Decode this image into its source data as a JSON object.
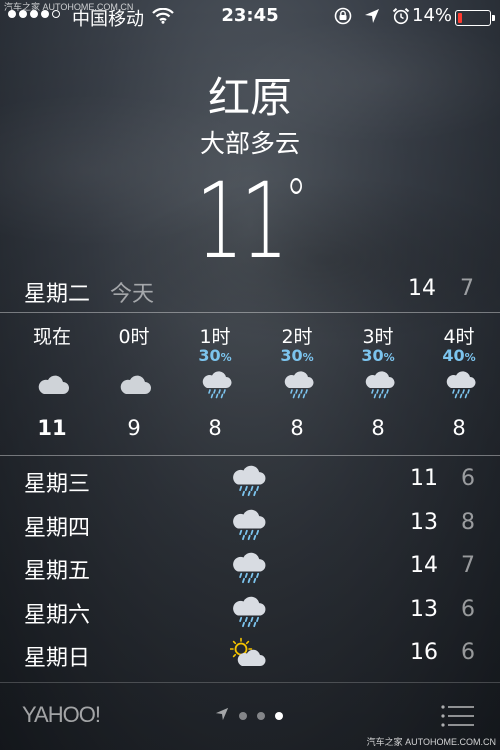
{
  "status_bar": {
    "carrier": "中国移动",
    "time": "23:45",
    "battery_percent": "14%",
    "battery_level": 0.14,
    "battery_color": "#ff3b30",
    "icons": [
      "orientation-lock-icon",
      "location-arrow-icon",
      "alarm-icon"
    ]
  },
  "watermark": {
    "top": "汽车之家 AUTOHOME.COM.CN",
    "bottom": "汽车之家 AUTOHOME.COM.CN"
  },
  "location": {
    "city": "红原",
    "condition": "大部多云",
    "temperature": "11",
    "degree": "°"
  },
  "today": {
    "day": "星期二",
    "label": "今天",
    "high": "14",
    "low": "7"
  },
  "hourly": [
    {
      "label": "现在",
      "precip": "",
      "pct": "",
      "icon": "cloud-icon",
      "temp": "11"
    },
    {
      "label": "0时",
      "precip": "",
      "pct": "",
      "icon": "cloud-icon",
      "temp": "9"
    },
    {
      "label": "1时",
      "precip": "30",
      "pct": "%",
      "icon": "rain-cloud-icon",
      "temp": "8"
    },
    {
      "label": "2时",
      "precip": "30",
      "pct": "%",
      "icon": "rain-cloud-icon",
      "temp": "8"
    },
    {
      "label": "3时",
      "precip": "30",
      "pct": "%",
      "icon": "rain-cloud-icon",
      "temp": "8"
    },
    {
      "label": "4时",
      "precip": "40",
      "pct": "%",
      "icon": "rain-cloud-icon",
      "temp": "8"
    }
  ],
  "daily": [
    {
      "day": "星期三",
      "icon": "rain-cloud-icon",
      "high": "11",
      "low": "6"
    },
    {
      "day": "星期四",
      "icon": "rain-cloud-icon",
      "high": "13",
      "low": "8"
    },
    {
      "day": "星期五",
      "icon": "rain-cloud-icon",
      "high": "14",
      "low": "7"
    },
    {
      "day": "星期六",
      "icon": "rain-cloud-icon",
      "high": "13",
      "low": "6"
    },
    {
      "day": "星期日",
      "icon": "partly-sunny-icon",
      "high": "16",
      "low": "6"
    }
  ],
  "bottom_bar": {
    "brand": "YAHOO!",
    "pages": 3,
    "active_page": 3
  },
  "colors": {
    "precip": "#7cc4ee",
    "sun": "#f5c400"
  }
}
